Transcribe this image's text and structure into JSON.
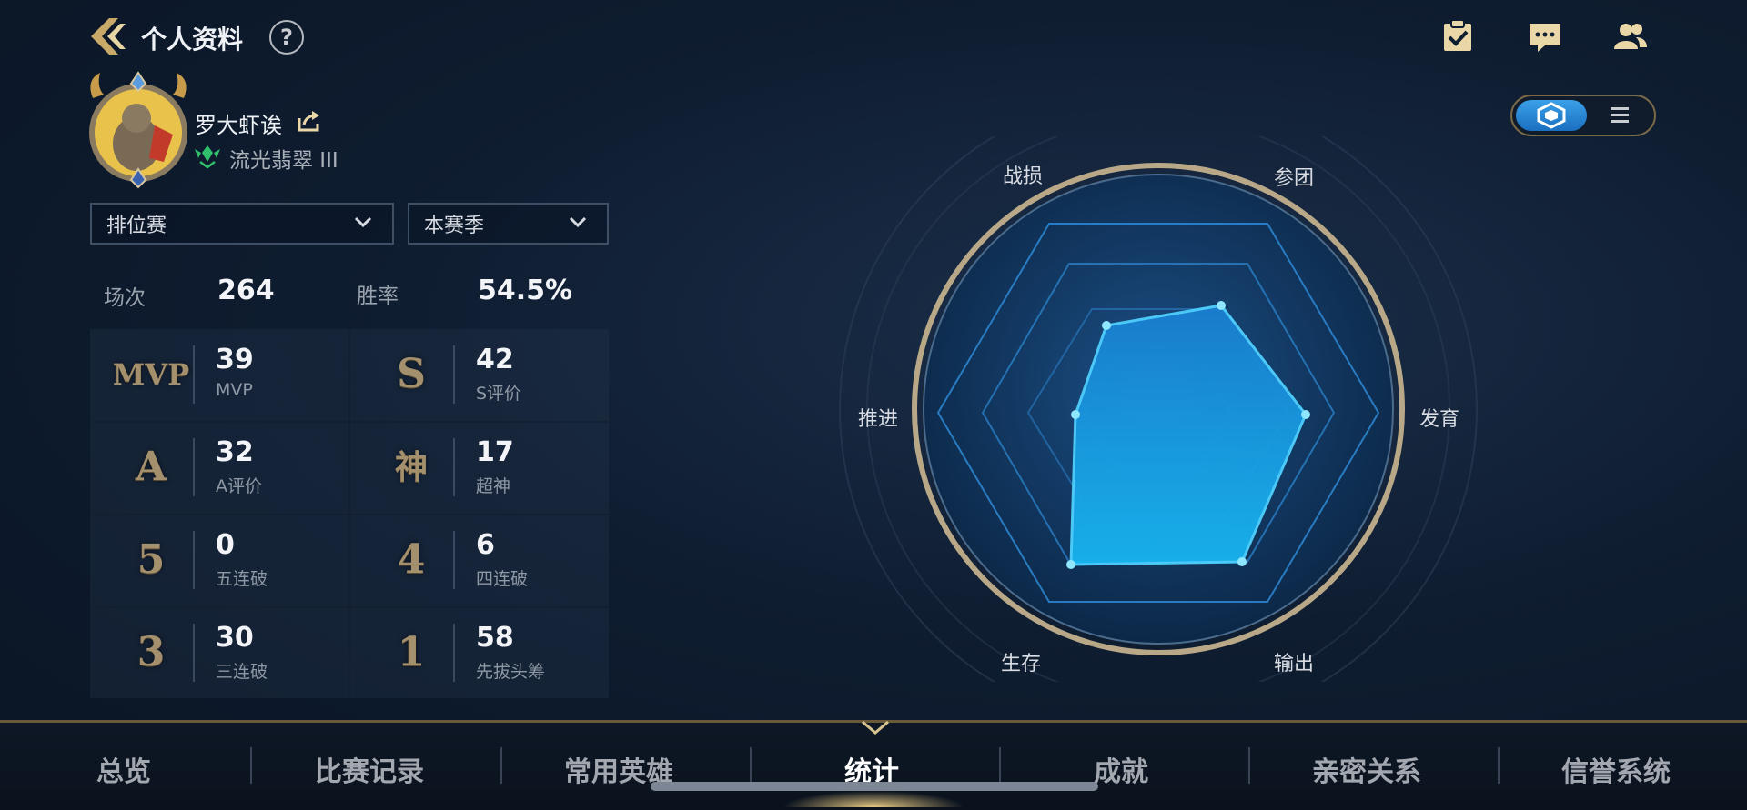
{
  "header": {
    "title": "个人资料",
    "help_label": "?",
    "icons": [
      "back-arrow-icon",
      "help-icon",
      "task-clipboard-icon",
      "chat-icon",
      "friends-icon"
    ]
  },
  "profile": {
    "name": "罗大虾诶",
    "rank": "流光翡翠 III"
  },
  "filters": {
    "mode": "排位赛",
    "season": "本赛季"
  },
  "summary": {
    "matches_label": "场次",
    "matches_value": "264",
    "winrate_label": "胜率",
    "winrate_value": "54.5%"
  },
  "stats": [
    {
      "icon": "MVP",
      "value": "39",
      "label": "MVP"
    },
    {
      "icon": "S",
      "value": "42",
      "label": "S评价"
    },
    {
      "icon": "A",
      "value": "32",
      "label": "A评价"
    },
    {
      "icon": "神",
      "value": "17",
      "label": "超神"
    },
    {
      "icon": "5",
      "value": "0",
      "label": "五连破"
    },
    {
      "icon": "4",
      "value": "6",
      "label": "四连破"
    },
    {
      "icon": "3",
      "value": "30",
      "label": "三连破"
    },
    {
      "icon": "1",
      "value": "58",
      "label": "先拔头筹"
    }
  ],
  "side_id": "31974797",
  "radar": {
    "labels": {
      "top_left": "战损",
      "top_right": "参团",
      "right": "发育",
      "bottom_right": "输出",
      "bottom_left": "生存",
      "left": "推进"
    },
    "accent": "#1aa8f0",
    "ring_color": "#b9a887"
  },
  "view_toggle": {
    "active": "radar",
    "icons": [
      "hexagon-view-icon",
      "list-view-icon"
    ]
  },
  "tabs": [
    {
      "label": "总览",
      "active": false
    },
    {
      "label": "比赛记录",
      "active": false
    },
    {
      "label": "常用英雄",
      "active": false
    },
    {
      "label": "统计",
      "active": true
    },
    {
      "label": "成就",
      "active": false
    },
    {
      "label": "亲密关系",
      "active": false
    },
    {
      "label": "信誉系统",
      "active": false
    }
  ],
  "colors": {
    "gold": "#b9a26a",
    "text": "#eef1f5",
    "muted": "#8e98a4"
  }
}
